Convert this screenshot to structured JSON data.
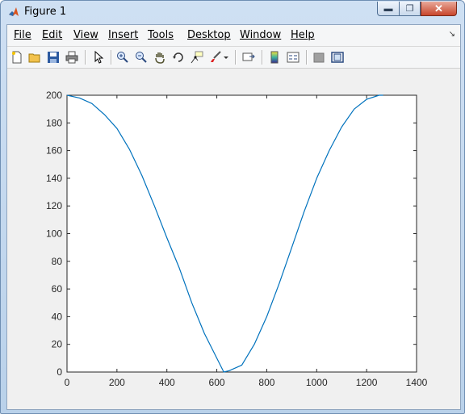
{
  "window": {
    "title": "Figure 1"
  },
  "menu": [
    "File",
    "Edit",
    "View",
    "Insert",
    "Tools",
    "Desktop",
    "Window",
    "Help"
  ],
  "toolbar": {
    "icons": [
      "new-figure-icon",
      "open-file-icon",
      "save-icon",
      "print-icon",
      "pointer-icon",
      "zoom-in-icon",
      "zoom-out-icon",
      "pan-hand-icon",
      "rotate-3d-icon",
      "data-cursor-icon",
      "brush-icon",
      "dropdown-arrow-icon",
      "link-plot-icon",
      "colorbar-icon",
      "legend-icon",
      "hide-plot-tools-icon",
      "show-plot-tools-icon"
    ]
  },
  "colors": {
    "line": "#0072BD",
    "axes_bg": "#ffffff",
    "figure_bg": "#f0f0f0"
  },
  "chart_data": {
    "type": "line",
    "title": "",
    "xlabel": "",
    "ylabel": "",
    "xlim": [
      0,
      1400
    ],
    "ylim": [
      0,
      200
    ],
    "xticks": [
      0,
      200,
      400,
      600,
      800,
      1000,
      1200,
      1400
    ],
    "yticks": [
      0,
      20,
      40,
      60,
      80,
      100,
      120,
      140,
      160,
      180,
      200
    ],
    "grid": false,
    "series": [
      {
        "x": [
          0,
          50,
          100,
          150,
          200,
          250,
          300,
          350,
          400,
          450,
          500,
          550,
          600,
          628,
          650,
          700,
          750,
          800,
          850,
          900,
          950,
          1000,
          1050,
          1100,
          1150,
          1200,
          1250,
          1266
        ],
        "y": [
          200,
          198,
          194,
          186,
          176,
          161,
          142,
          120,
          97,
          75,
          50,
          28,
          10,
          0,
          1,
          5,
          20,
          40,
          64,
          90,
          116,
          140,
          160,
          177,
          190,
          197,
          200,
          200
        ]
      }
    ]
  }
}
